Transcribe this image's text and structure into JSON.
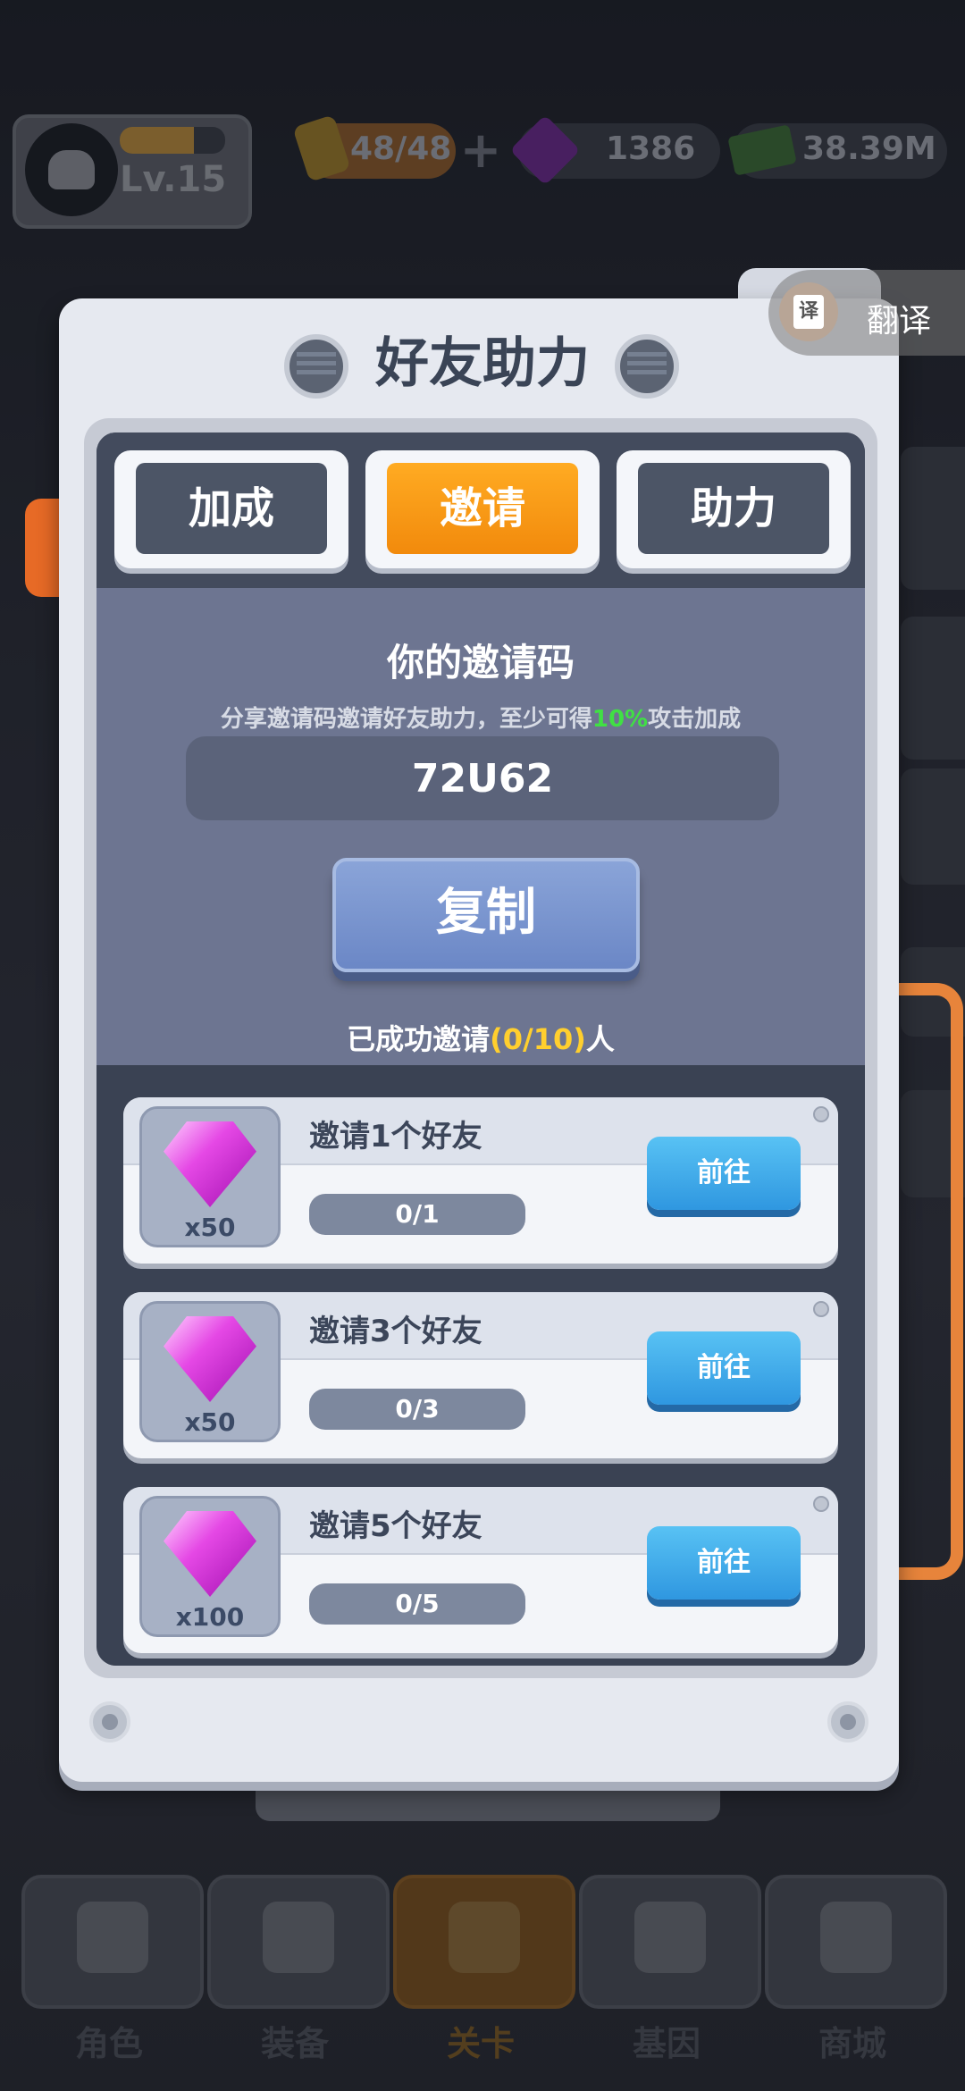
{
  "hud": {
    "level": "Lv.15",
    "xp_fraction": 0.7,
    "energy": "48/48",
    "gems": "1386",
    "cash": "38.39M",
    "plus": "+"
  },
  "translate": {
    "icon_char": "译",
    "label": "翻译"
  },
  "dialog": {
    "title": "好友助力",
    "tabs": [
      {
        "label": "加成",
        "active": false
      },
      {
        "label": "邀请",
        "active": true
      },
      {
        "label": "助力",
        "active": false
      }
    ],
    "invite": {
      "title": "你的邀请码",
      "desc_prefix": "分享邀请码邀请好友助力，至少可得",
      "desc_highlight": "10%",
      "desc_suffix": "攻击加成",
      "code": "72U62",
      "copy_label": "复制",
      "success_prefix": "已成功邀请",
      "success_count": "(0/10)",
      "success_suffix": "人"
    },
    "rewards": [
      {
        "title": "邀请1个好友",
        "qty": "x50",
        "progress": "0/1",
        "button": "前往"
      },
      {
        "title": "邀请3个好友",
        "qty": "x50",
        "progress": "0/3",
        "button": "前往"
      },
      {
        "title": "邀请5个好友",
        "qty": "x100",
        "progress": "0/5",
        "button": "前往"
      }
    ]
  },
  "nav": [
    {
      "label": "角色",
      "icon": "skull-icon",
      "active": false
    },
    {
      "label": "装备",
      "icon": "gun-icon",
      "active": false
    },
    {
      "label": "关卡",
      "icon": "map-pin-icon",
      "active": true
    },
    {
      "label": "基因",
      "icon": "hexagons-icon",
      "active": false
    },
    {
      "label": "商城",
      "icon": "shop-icon",
      "active": false
    }
  ],
  "colors": {
    "active_tab": "#f28a0c",
    "highlight_green": "#40e044",
    "highlight_yellow": "#ffcf2e",
    "go_button": "#2f97e0",
    "copy_button": "#6b87c6"
  }
}
